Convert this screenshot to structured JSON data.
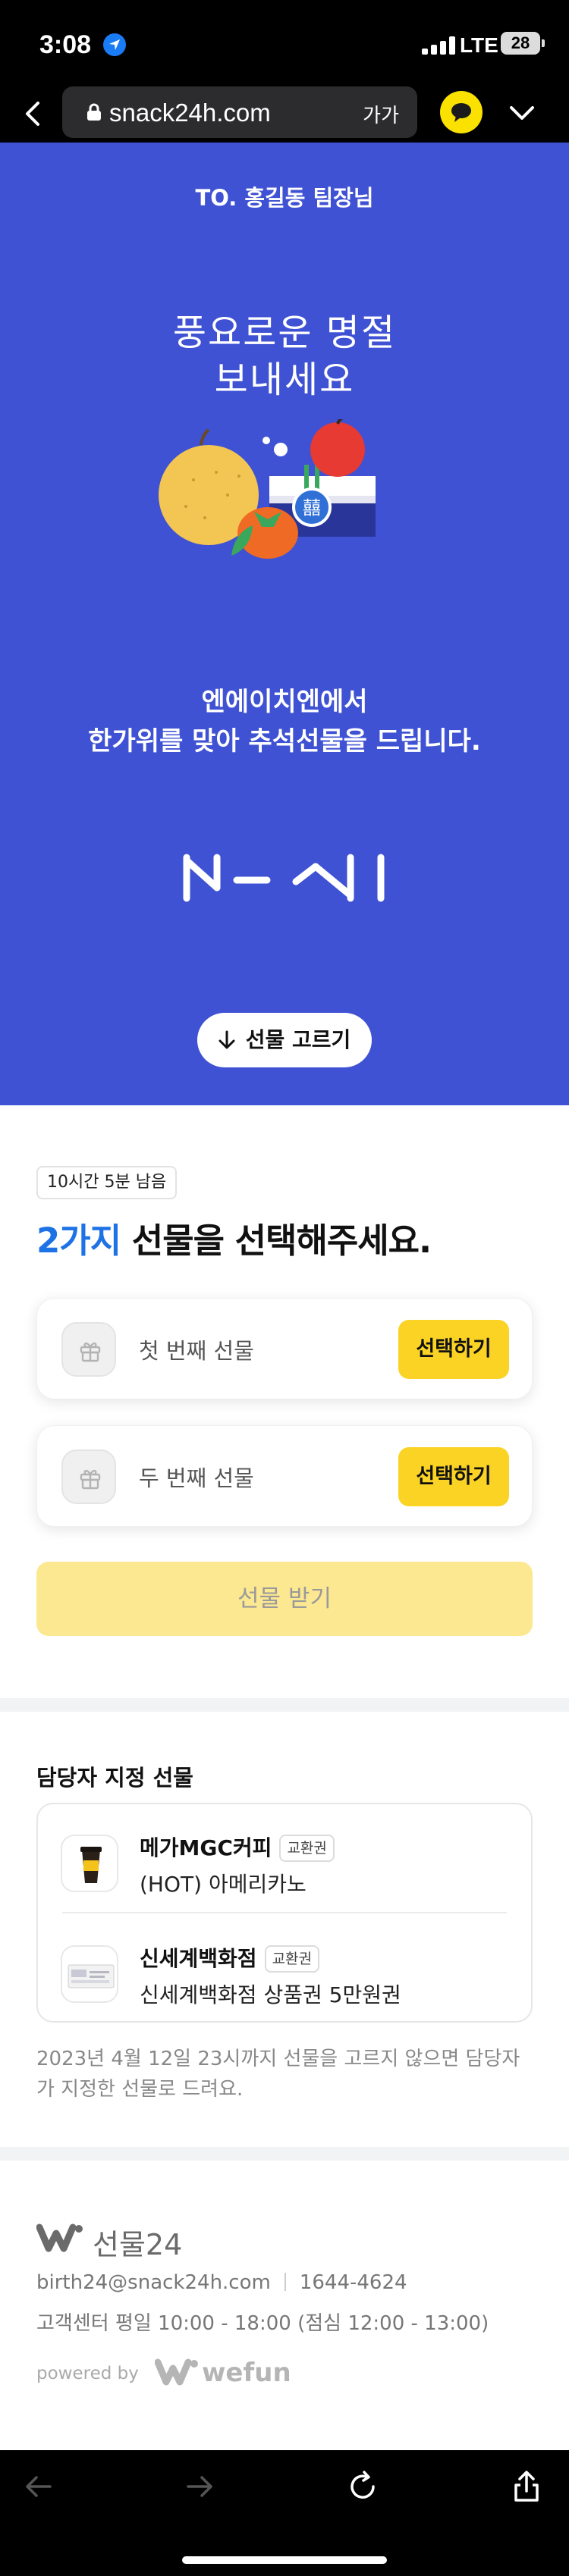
{
  "status_bar": {
    "time": "3:08",
    "network": "LTE",
    "battery": "28"
  },
  "browser": {
    "url": "snack24h.com",
    "text_size_label": "가가"
  },
  "hero": {
    "recipient": "TO. 홍길동 팀장님",
    "title_line1": "풍요로운 명절",
    "title_line2": "보내세요",
    "message_line1": "엔에이치엔에서",
    "message_line2": "한가위를 맞아 추석선물을 드립니다.",
    "pick_button": "선물 고르기",
    "illustration_seal": "囍",
    "colors": {
      "background": "#3f52d3"
    }
  },
  "selection": {
    "timer": "10시간 5분 남음",
    "title_count": "2가지",
    "title_rest": " 선물을 선택해주세요.",
    "slots": [
      {
        "label": "첫 번째 선물",
        "button": "선택하기"
      },
      {
        "label": "두 번째 선물",
        "button": "선택하기"
      }
    ],
    "receive_button": "선물 받기",
    "colors": {
      "accent": "#1d72e6",
      "select_button": "#fbd324",
      "receive_disabled": "#fce891"
    }
  },
  "manager_gift": {
    "title": "담당자 지정 선물",
    "items": [
      {
        "brand": "메가MGC커피",
        "badge": "교환권",
        "product": "(HOT) 아메리카노",
        "icon": "coffee-cup-icon"
      },
      {
        "brand": "신세계백화점",
        "badge": "교환권",
        "product": "신세계백화점 상품권 5만원권",
        "icon": "gift-card-icon"
      }
    ],
    "notice": "2023년 4월 12일 23시까지 선물을 고르지 않으면 담당자가 지정한 선물로 드려요."
  },
  "footer": {
    "brand": "선물24",
    "email": "birth24@snack24h.com",
    "phone": "1644-4624",
    "hours": "고객센터 평일 10:00 - 18:00 (점심 12:00 - 13:00)",
    "powered_by": "powered by",
    "powered_brand": "wefun"
  }
}
